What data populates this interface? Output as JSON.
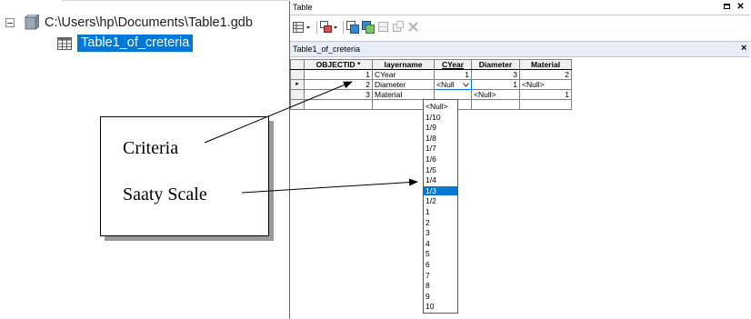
{
  "catalog_tree": {
    "gdb_path": "C:\\Users\\hp\\Documents\\Table1.gdb",
    "table_name": "Table1_of_creteria"
  },
  "window": {
    "title": "Table",
    "maximize_icon": "maximize-icon",
    "close_icon": "close-icon"
  },
  "toolbar": {
    "icons": [
      "table-options-icon",
      "related-tables-icon",
      "select-by-attributes-icon",
      "switch-selection-icon",
      "clear-selection-icon",
      "zoom-to-selected-icon",
      "delete-selected-icon"
    ]
  },
  "tab": {
    "label": "Table1_of_creteria",
    "close": "×"
  },
  "grid": {
    "columns": [
      "OBJECTID *",
      "layername",
      "CYear",
      "Diameter",
      "Material"
    ],
    "rows": [
      {
        "marker": "",
        "objectid": "1",
        "layername": "CYear",
        "cyear": "1",
        "diameter": "3",
        "material": "2"
      },
      {
        "marker": "▸",
        "objectid": "2",
        "layername": "Diameter",
        "cyear": "<Null",
        "diameter": "1",
        "material": "<Null>"
      },
      {
        "marker": "",
        "objectid": "3",
        "layername": "Material",
        "cyear": "",
        "diameter": "<Null>",
        "material": "1"
      }
    ]
  },
  "dropdown": {
    "options": [
      "<Null>",
      "1/10",
      "1/9",
      "1/8",
      "1/7",
      "1/6",
      "1/5",
      "1/4",
      "1/3",
      "1/2",
      "1",
      "2",
      "3",
      "4",
      "5",
      "6",
      "7",
      "8",
      "9",
      "10"
    ],
    "highlighted": "1/3"
  },
  "callout": {
    "label_criteria": "Criteria",
    "label_saaty": "Saaty Scale"
  },
  "colors": {
    "selection": "#0078d7",
    "tab_bar": "#e6eef8"
  }
}
